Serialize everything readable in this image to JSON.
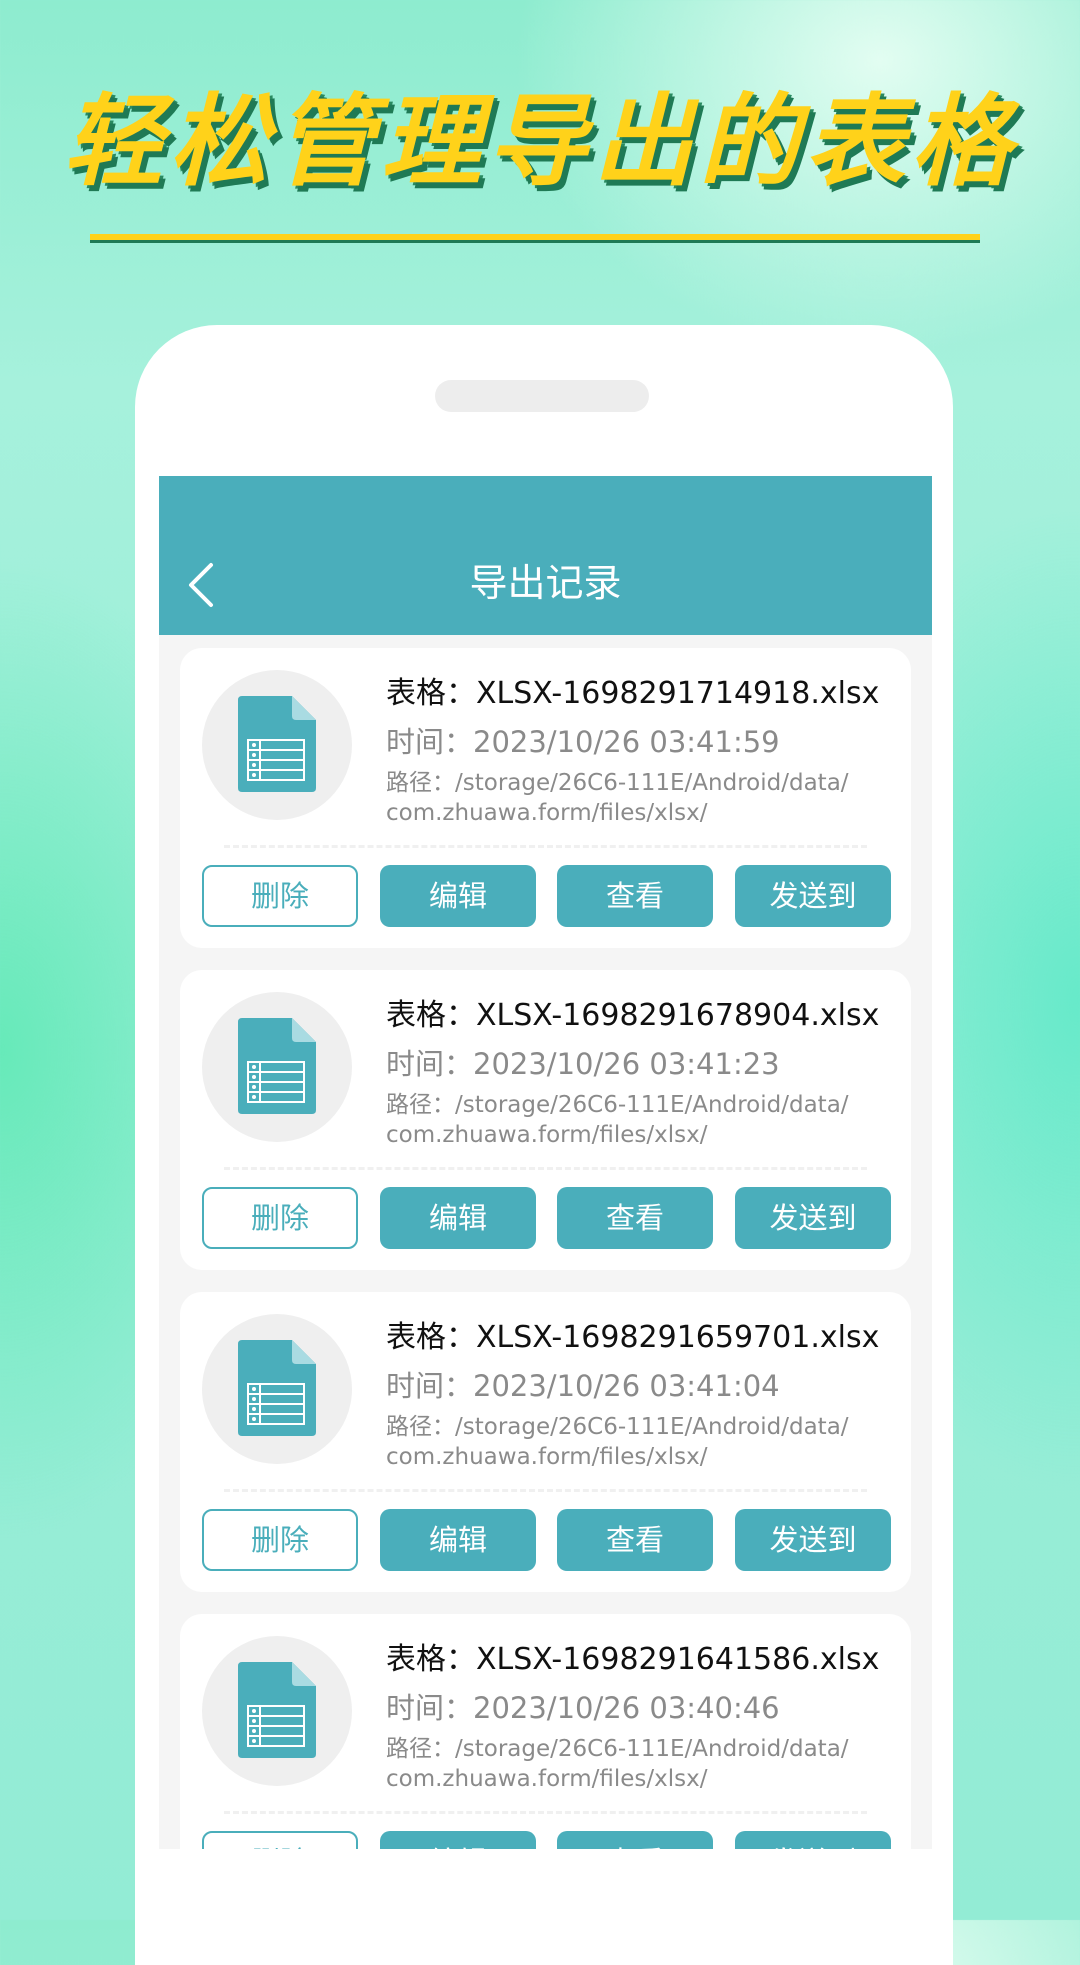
{
  "headline": "轻松管理导出的表格",
  "appbar": {
    "title": "导出记录"
  },
  "colors": {
    "primary": "#4aaebb",
    "headline": "#ffd21a"
  },
  "records": [
    {
      "name": "表格：XLSX-1698291714918.xlsx",
      "time": "时间：2023/10/26 03:41:59",
      "path_line1": "路径：/storage/26C6-111E/Android/data/",
      "path_line2": "com.zhuawa.form/files/xlsx/",
      "buttons": {
        "delete": "删除",
        "edit": "编辑",
        "view": "查看",
        "send": "发送到"
      }
    },
    {
      "name": "表格：XLSX-1698291678904.xlsx",
      "time": "时间：2023/10/26 03:41:23",
      "path_line1": "路径：/storage/26C6-111E/Android/data/",
      "path_line2": "com.zhuawa.form/files/xlsx/",
      "buttons": {
        "delete": "删除",
        "edit": "编辑",
        "view": "查看",
        "send": "发送到"
      }
    },
    {
      "name": "表格：XLSX-1698291659701.xlsx",
      "time": "时间：2023/10/26 03:41:04",
      "path_line1": "路径：/storage/26C6-111E/Android/data/",
      "path_line2": "com.zhuawa.form/files/xlsx/",
      "buttons": {
        "delete": "删除",
        "edit": "编辑",
        "view": "查看",
        "send": "发送到"
      }
    },
    {
      "name": "表格：XLSX-1698291641586.xlsx",
      "time": "时间：2023/10/26 03:40:46",
      "path_line1": "路径：/storage/26C6-111E/Android/data/",
      "path_line2": "com.zhuawa.form/files/xlsx/",
      "buttons": {
        "delete": "删除",
        "edit": "编辑",
        "view": "查看",
        "send": "发送到"
      }
    }
  ]
}
